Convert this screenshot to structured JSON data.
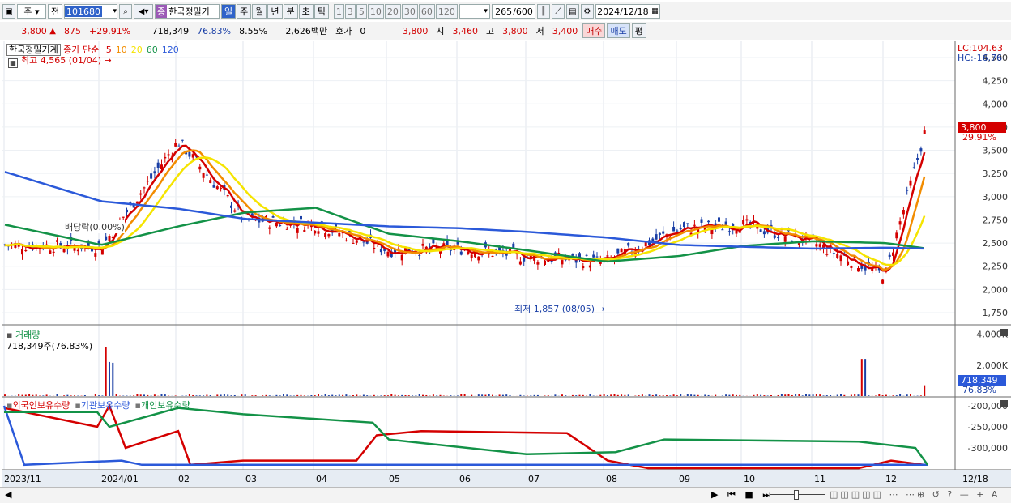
{
  "toolbar": {
    "market": "주",
    "prefix": "전",
    "code": "101680",
    "badge": "종",
    "name": "한국정밀기",
    "periods": [
      "일",
      "주",
      "월",
      "년",
      "분",
      "초",
      "틱"
    ],
    "intervals": [
      "1",
      "3",
      "5",
      "10",
      "20",
      "30",
      "60",
      "120"
    ],
    "count": "265",
    "count_total": "/600",
    "date": "2024/12/18"
  },
  "quote": {
    "price": "3,800",
    "change": "875",
    "change_pct": "+29.91%",
    "volume": "718,349",
    "vol_ratio": "76.83%",
    "turnover": "8.55%",
    "amount": "2,626백만",
    "hoga_label": "호가",
    "hoga": "0",
    "hoga_price": "3,800",
    "open_label": "시",
    "open": "3,460",
    "high_label": "고",
    "high": "3,800",
    "low_label": "저",
    "low": "3,400",
    "buy": "매수",
    "sell": "매도",
    "avg": "평"
  },
  "price_panel": {
    "legend_name": "한국정밀기계",
    "legend_series": "종가 단순",
    "ma_labels": [
      "5",
      "10",
      "20",
      "60",
      "120"
    ],
    "ma_colors": [
      "#d40000",
      "#f28c00",
      "#f5e400",
      "#139247",
      "#2b59d9"
    ],
    "high_note": "최고 4,565 (01/04)",
    "low_note": "최저 1,857 (08/05)",
    "dividend_note": "배당락(0.00%)",
    "lc": "LC:104.63",
    "hc": "HC:-16.76",
    "y_ticks": [
      "4,500",
      "4,250",
      "4,000",
      "3,750",
      "3,500",
      "3,250",
      "3,000",
      "2,750",
      "2,500",
      "2,250",
      "2,000",
      "1,750"
    ],
    "last_price": "3,800",
    "last_pct": "29.91%"
  },
  "volume_panel": {
    "title": "거래량",
    "subtitle": "718,349주(76.83%)",
    "y_ticks": [
      "4,000K",
      "2,000K"
    ],
    "last": "718,349",
    "last_pct": "76.83%"
  },
  "holding_panel": {
    "legends": [
      "외국인보유수량",
      "기관보유수량",
      "개인보유수량"
    ],
    "colors": [
      "#d40000",
      "#2b59d9",
      "#139247"
    ],
    "y_ticks": [
      "-200,000",
      "-250,000",
      "-300,000"
    ]
  },
  "x_axis": [
    "2023/11",
    "2024/01",
    "02",
    "03",
    "04",
    "05",
    "06",
    "07",
    "08",
    "09",
    "10",
    "11",
    "12",
    "12/18"
  ],
  "chart_data": {
    "type": "line",
    "title": "한국정밀기계",
    "x": [
      "2023/11",
      "2024/01",
      "02",
      "03",
      "04",
      "05",
      "06",
      "07",
      "08",
      "09",
      "10",
      "11",
      "12",
      "12/18"
    ],
    "ylim": [
      1750,
      4500
    ],
    "series": [
      {
        "name": "종가",
        "values": [
          2480,
          2460,
          3600,
          2750,
          2700,
          2420,
          2440,
          2350,
          2300,
          2650,
          2700,
          2500,
          2150,
          3800
        ]
      },
      {
        "name": "120",
        "values": [
          3270,
          2950,
          2870,
          2760,
          2720,
          2680,
          2660,
          2620,
          2560,
          2480,
          2460,
          2440,
          2450,
          2440
        ]
      },
      {
        "name": "60",
        "values": [
          2700,
          2480,
          2680,
          2830,
          2880,
          2600,
          2520,
          2420,
          2300,
          2360,
          2470,
          2520,
          2500,
          2440
        ]
      }
    ]
  }
}
